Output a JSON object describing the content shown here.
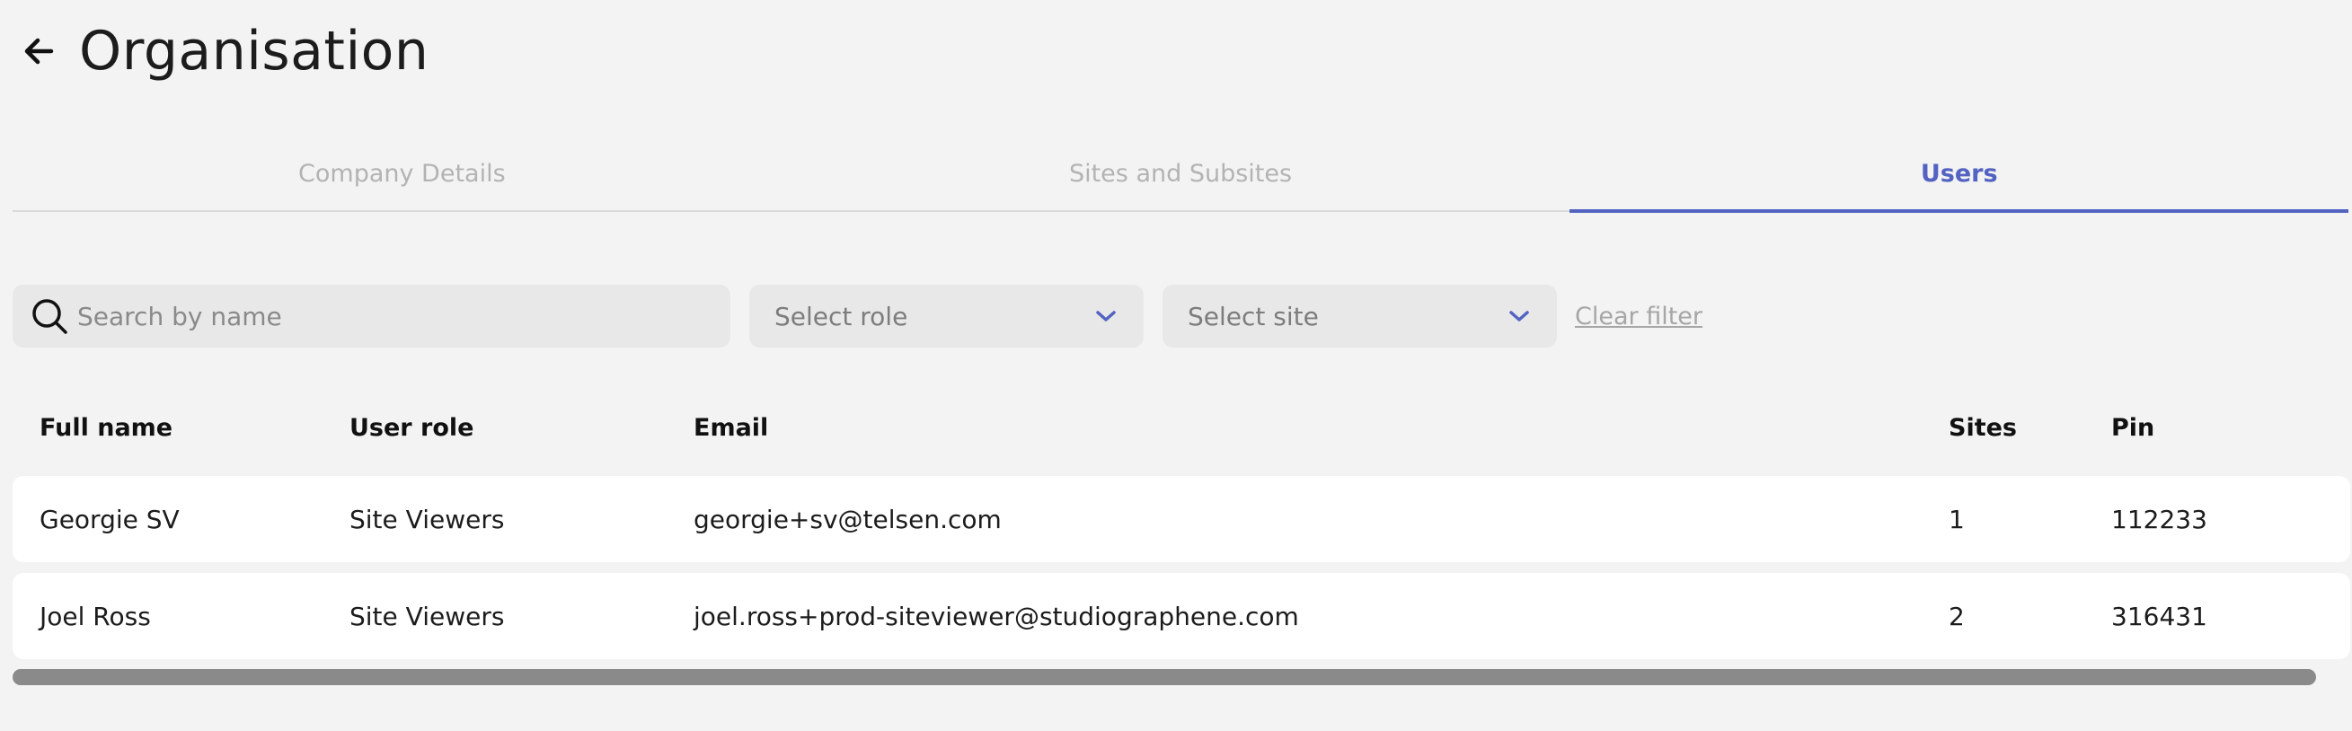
{
  "header": {
    "title": "Organisation",
    "back_icon": "arrow-left-icon"
  },
  "tabs": [
    {
      "label": "Company Details",
      "active": false
    },
    {
      "label": "Sites and Subsites",
      "active": false
    },
    {
      "label": "Users",
      "active": true
    }
  ],
  "filters": {
    "search_placeholder": "Search by name",
    "search_value": "",
    "role_select": {
      "label": "Select role"
    },
    "site_select": {
      "label": "Select site"
    },
    "clear_label": "Clear filter"
  },
  "table": {
    "columns": [
      "Full name",
      "User role",
      "Email",
      "Sites",
      "Pin"
    ],
    "rows": [
      {
        "name": "Georgie SV",
        "role": "Site Viewers",
        "email": "georgie+sv@telsen.com",
        "sites": "1",
        "pin": "112233"
      },
      {
        "name": "Joel Ross",
        "role": "Site Viewers",
        "email": "joel.ross+prod-siteviewer@studiographene.com",
        "sites": "2",
        "pin": "316431"
      }
    ]
  },
  "colors": {
    "accent": "#5363c2",
    "background": "#f3f3f3",
    "input_bg": "#e8e8e8"
  }
}
